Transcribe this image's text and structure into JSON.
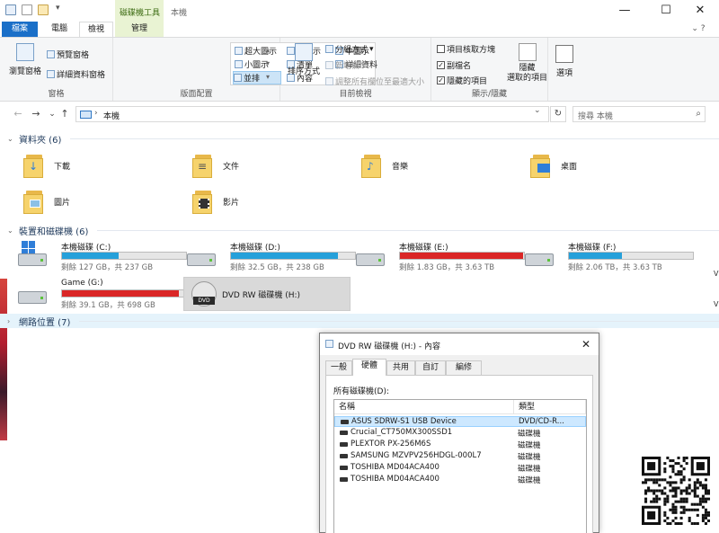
{
  "titlebar": {
    "tool_tab_group": "磁碟機工具",
    "window_title": "本機",
    "controls": {
      "minimize": "—",
      "maximize": "☐",
      "close": "✕"
    }
  },
  "ribbon_tabs": {
    "file": "檔案",
    "home": "電腦",
    "view": "檢視",
    "manage": "管理",
    "help": "⌄ ?"
  },
  "ribbon": {
    "panes": {
      "label": "窗格",
      "navigation_pane": "瀏覽窗格",
      "preview_pane": "預覽窗格",
      "details_pane": "詳細資料窗格"
    },
    "layout": {
      "label": "版面配置",
      "items": [
        "超大圖示",
        "大圖示",
        "中圖示",
        "小圖示",
        "清單",
        "詳細資料",
        "並排",
        "內容"
      ]
    },
    "current_view": {
      "label": "目前檢視",
      "sort_by": "排序方式",
      "group_by": "分組方式",
      "add_columns": "新增欄",
      "size_columns": "調整所有欄位至最適大小"
    },
    "show_hide": {
      "label": "顯示/隱藏",
      "item_checkboxes": "項目核取方塊",
      "file_name_extensions": "副檔名",
      "hidden_items": "隱藏的項目",
      "hide_selected": "隱藏\n選取的項目",
      "options": "選項"
    }
  },
  "address": {
    "back": "←",
    "forward": "→",
    "recent": "⌄",
    "up": "↑",
    "chevron": "›",
    "path": "本機",
    "dropdown": "⌄",
    "refresh": "↻",
    "search_placeholder": "搜尋 本機",
    "search_icon": "⌕"
  },
  "sections": {
    "folders": "資料夾 (6)",
    "devices": "裝置和磁碟機 (6)",
    "network": "網路位置 (7)"
  },
  "folders": [
    {
      "name": "下載",
      "icon": "download-folder-icon"
    },
    {
      "name": "文件",
      "icon": "documents-folder-icon"
    },
    {
      "name": "音樂",
      "icon": "music-folder-icon"
    },
    {
      "name": "桌面",
      "icon": "desktop-folder-icon"
    },
    {
      "name": "圖片",
      "icon": "pictures-folder-icon"
    },
    {
      "name": "影片",
      "icon": "videos-folder-icon"
    }
  ],
  "drives": [
    {
      "name": "本機磁碟 (C:)",
      "info": "剩餘 127 GB，共 237 GB",
      "used_fraction": 0.46,
      "bar_color": "#26a0da"
    },
    {
      "name": "本機磁碟 (D:)",
      "info": "剩餘 32.5 GB，共 238 GB",
      "used_fraction": 0.86,
      "bar_color": "#26a0da"
    },
    {
      "name": "本機磁碟 (E:)",
      "info": "剩餘 1.83 GB，共 3.63 TB",
      "used_fraction": 0.99,
      "bar_color": "#da2626"
    },
    {
      "name": "本機磁碟 (F:)",
      "info": "剩餘 2.06 TB，共 3.63 TB",
      "used_fraction": 0.43,
      "bar_color": "#26a0da"
    },
    {
      "name": "Game (G:)",
      "info": "剩餘 39.1 GB，共 698 GB",
      "used_fraction": 0.94,
      "bar_color": "#da2626"
    },
    {
      "name": "DVD RW 磁碟機 (H:)",
      "info": "",
      "dvd_label": "DVD"
    }
  ],
  "dialog": {
    "title": "DVD RW 磁碟機 (H:) - 內容",
    "close": "✕",
    "tabs": [
      "一般",
      "硬體",
      "共用",
      "自訂",
      "編修"
    ],
    "all_disks_label": "所有磁碟機(D):",
    "columns": {
      "name": "名稱",
      "type": "類型"
    },
    "rows": [
      {
        "name": "ASUS SDRW-S1 USB Device",
        "type": "DVD/CD-R..."
      },
      {
        "name": "Crucial_CT750MX300SSD1",
        "type": "磁碟機"
      },
      {
        "name": "PLEXTOR PX-256M6S",
        "type": "磁碟機"
      },
      {
        "name": "SAMSUNG MZVPV256HDGL-000L7",
        "type": "磁碟機"
      },
      {
        "name": "TOSHIBA MD04ACA400",
        "type": "磁碟機"
      },
      {
        "name": "TOSHIBA MD04ACA400",
        "type": "磁碟機"
      }
    ]
  },
  "background": {
    "edge_letters": [
      "V",
      "V"
    ]
  },
  "colors": {
    "accent": "#1a6fc8",
    "drive_ok": "#26a0da",
    "drive_full": "#da2626",
    "manage_tab": "#e9f3d3"
  }
}
